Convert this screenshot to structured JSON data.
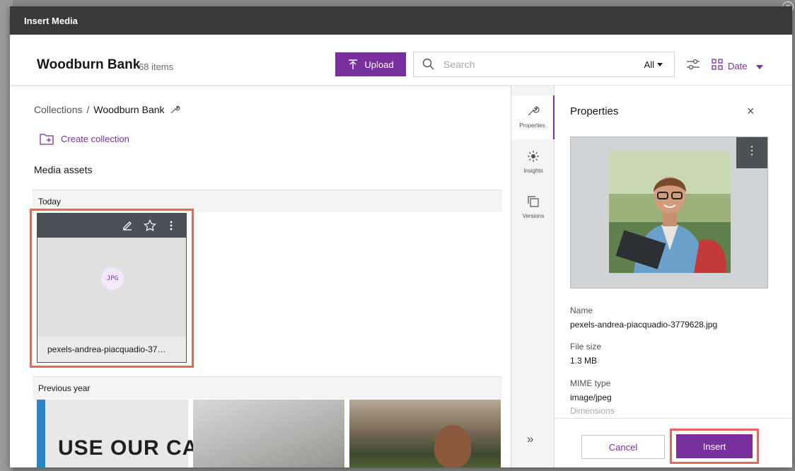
{
  "modal": {
    "title": "Insert Media"
  },
  "header": {
    "title": "Woodburn Bank",
    "count": "68 items",
    "upload_label": "Upload",
    "search_placeholder": "Search",
    "scope": "All",
    "sort_label": "Date"
  },
  "left": {
    "breadcrumb": {
      "root": "Collections",
      "separator": "/",
      "current": "Woodburn Bank"
    },
    "create_collection": "Create collection",
    "section_title": "Media assets",
    "groups": [
      "Today",
      "Previous year"
    ],
    "asset": {
      "type": "JPG",
      "name": "pexels-andrea-piacquadio-37…"
    },
    "thumb1_text": "USE OUR CA"
  },
  "rail": {
    "items": [
      "Properties",
      "Insights",
      "Versions"
    ],
    "expand": "»"
  },
  "properties": {
    "title": "Properties",
    "close": "×",
    "menu": "⋮",
    "fields": [
      {
        "label": "Name",
        "value": "pexels-andrea-piacquadio-3779628.jpg"
      },
      {
        "label": "File size",
        "value": "1.3 MB"
      },
      {
        "label": "MIME type",
        "value": "image/jpeg"
      }
    ],
    "faded_label": "Dimensions",
    "cancel_label": "Cancel",
    "insert_label": "Insert"
  },
  "colors": {
    "accent": "#7a2f9f",
    "highlight": "#e9675a",
    "titlebar": "#393939"
  }
}
